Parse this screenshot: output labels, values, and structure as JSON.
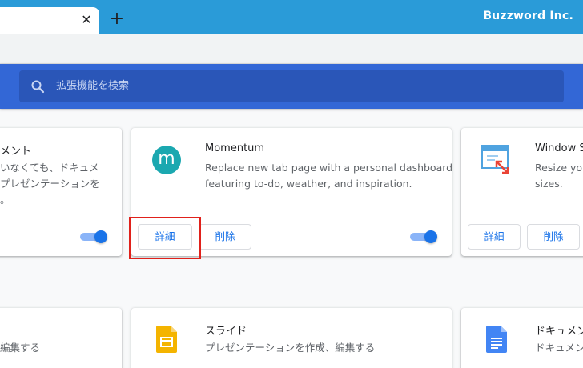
{
  "browser": {
    "new_tab_symbol": "+",
    "tab_close_symbol": "✕",
    "brand": "Buzzword Inc."
  },
  "search": {
    "placeholder": "拡張機能を検索"
  },
  "cards_row1": {
    "left": {
      "name": "メント",
      "desc_lines": [
        "いなくても、ドキュメ",
        "プレゼンテーションを",
        "。"
      ],
      "enabled": true
    },
    "momentum": {
      "icon_letter": "m",
      "name": "Momentum",
      "desc_lines": [
        "Replace new tab page with a personal dashboard",
        "featuring to-do, weather, and inspiration."
      ],
      "details_label": "詳細",
      "remove_label": "削除",
      "enabled": true
    },
    "window": {
      "name": "Window Si",
      "desc_lines": [
        "Resize you",
        "sizes."
      ],
      "details_label": "詳細",
      "remove_label": "削除"
    }
  },
  "cards_row2": {
    "left": {
      "desc": "編集する"
    },
    "slides": {
      "name": "スライド",
      "desc": "プレゼンテーションを作成、編集する"
    },
    "docs": {
      "name": "ドキュメン",
      "desc": "ドキュメン"
    }
  },
  "colors": {
    "header": "#3367d6",
    "tabstrip": "#2a9bd8",
    "accent": "#1a73e8",
    "highlight": "#e0211b"
  }
}
